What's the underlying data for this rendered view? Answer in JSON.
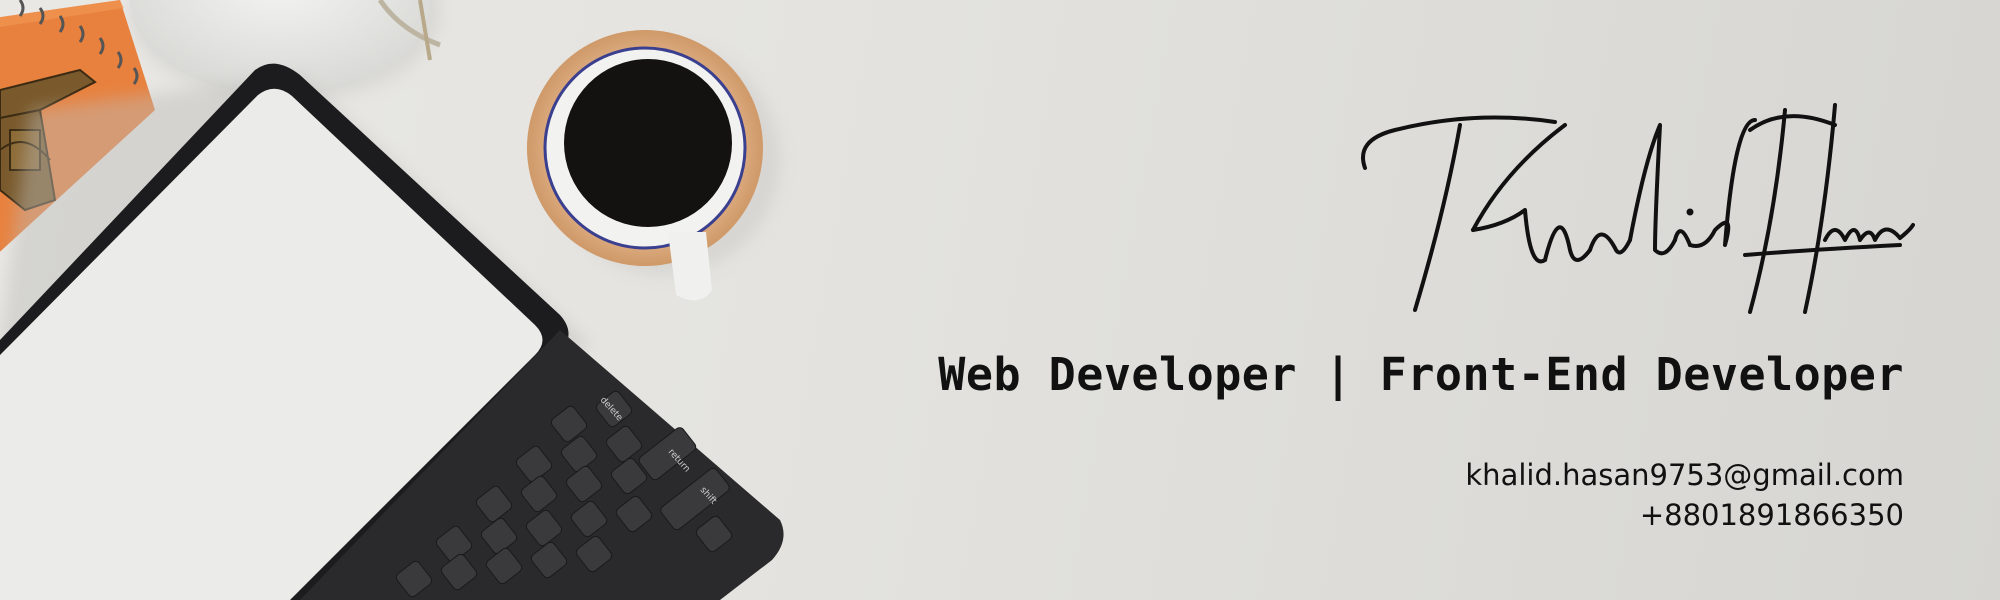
{
  "signature": {
    "text": "Khalid Hasan",
    "style": "handwritten-script"
  },
  "role": "Web Developer | Front-End Developer",
  "contact": {
    "email": "khalid.hasan9753@gmail.com",
    "phone": "+8801891866350"
  },
  "keyboard_keys": {
    "delete": "delete",
    "return": "return",
    "shift": "shift"
  },
  "colors": {
    "background": "#e4e3df",
    "text": "#111111",
    "notebook": "#e8813e",
    "coaster": "#d9a77a",
    "coffee": "#141210",
    "keyboard": "#2a2a2c",
    "tablet_screen": "#ebebe9"
  },
  "icons": [
    "eiffel-tower-figurine-icon",
    "coffee-cup-icon",
    "tablet-icon",
    "keyboard-icon",
    "notebook-icon",
    "vase-icon"
  ]
}
